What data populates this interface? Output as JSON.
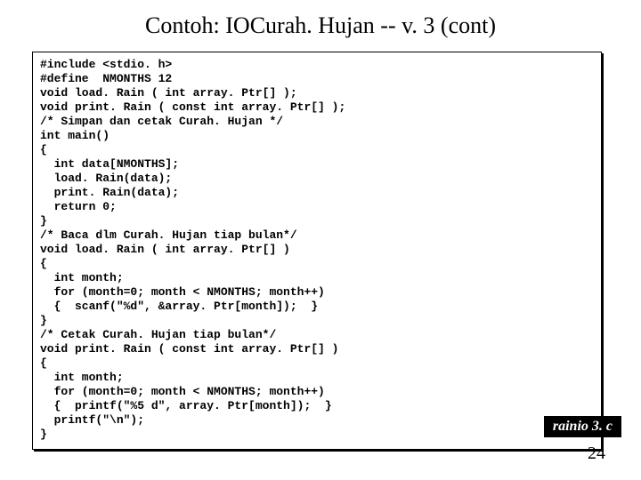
{
  "title": "Contoh: IOCurah. Hujan -- v. 3 (cont)",
  "code": "#include <stdio. h>\n#define  NMONTHS 12\nvoid load. Rain ( int array. Ptr[] );\nvoid print. Rain ( const int array. Ptr[] );\n/* Simpan dan cetak Curah. Hujan */\nint main()\n{\n  int data[NMONTHS];\n  load. Rain(data);\n  print. Rain(data);\n  return 0;\n}\n/* Baca dlm Curah. Hujan tiap bulan*/\nvoid load. Rain ( int array. Ptr[] )\n{\n  int month;\n  for (month=0; month < NMONTHS; month++)\n  {  scanf(\"%d\", &array. Ptr[month]);  }\n}\n/* Cetak Curah. Hujan tiap bulan*/\nvoid print. Rain ( const int array. Ptr[] )\n{\n  int month;\n  for (month=0; month < NMONTHS; month++)\n  {  printf(\"%5 d\", array. Ptr[month]);  }\n  printf(\"\\n\");\n}",
  "file_label": "rainio 3. c",
  "page_number": "24"
}
